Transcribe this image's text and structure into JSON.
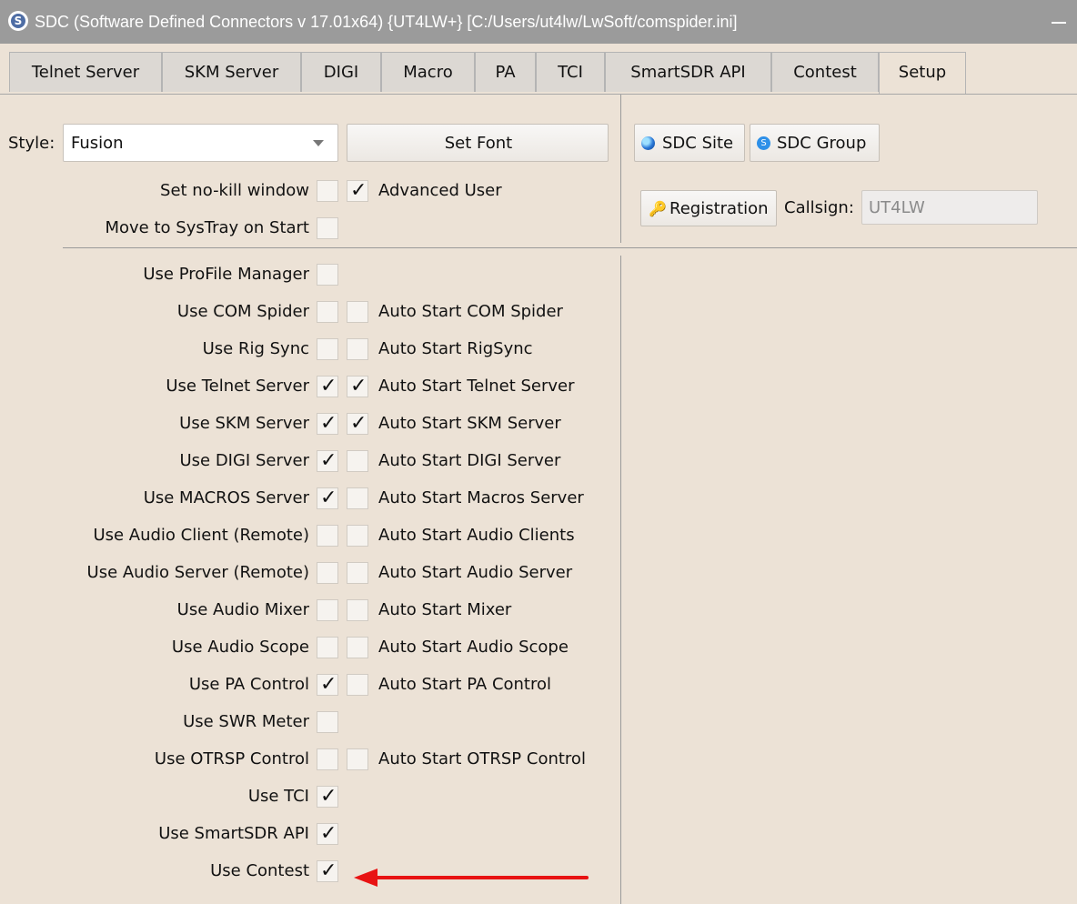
{
  "window": {
    "title": "SDC (Software Defined Connectors v 17.01x64) {UT4LW+} [C:/Users/ut4lw/LwSoft/comspider.ini]"
  },
  "tabs": [
    {
      "label": "Telnet Server",
      "active": false
    },
    {
      "label": "SKM Server",
      "active": false
    },
    {
      "label": "DIGI",
      "active": false
    },
    {
      "label": "Macro",
      "active": false
    },
    {
      "label": "PA",
      "active": false
    },
    {
      "label": "TCI",
      "active": false
    },
    {
      "label": "SmartSDR API",
      "active": false
    },
    {
      "label": "Contest",
      "active": false
    },
    {
      "label": "Setup",
      "active": true
    }
  ],
  "setup": {
    "style_label": "Style:",
    "style_value": "Fusion",
    "set_font_label": "Set Font",
    "no_kill_label": "Set no-kill window",
    "no_kill_checked": false,
    "advanced_user_checked": true,
    "advanced_user_label": "Advanced User",
    "systray_label": "Move to SysTray on Start",
    "systray_checked": false,
    "sdc_site_label": "SDC Site",
    "sdc_group_label": "SDC Group",
    "registration_label": "Registration",
    "callsign_label": "Callsign:",
    "callsign_value": "UT4LW",
    "options": [
      {
        "label": "Use ProFile Manager",
        "checked": false
      },
      {
        "label": "Use COM Spider",
        "checked": false,
        "auto_checked": false,
        "auto_label": "Auto Start COM Spider"
      },
      {
        "label": "Use Rig Sync",
        "checked": false,
        "auto_checked": false,
        "auto_label": "Auto Start RigSync"
      },
      {
        "label": "Use Telnet Server",
        "checked": true,
        "auto_checked": true,
        "auto_label": "Auto Start Telnet Server"
      },
      {
        "label": "Use SKM Server",
        "checked": true,
        "auto_checked": true,
        "auto_label": "Auto Start SKM Server"
      },
      {
        "label": "Use DIGI Server",
        "checked": true,
        "auto_checked": false,
        "auto_label": "Auto Start DIGI Server"
      },
      {
        "label": "Use MACROS Server",
        "checked": true,
        "auto_checked": false,
        "auto_label": "Auto Start Macros Server"
      },
      {
        "label": "Use Audio Client (Remote)",
        "checked": false,
        "auto_checked": false,
        "auto_label": "Auto Start Audio Clients"
      },
      {
        "label": "Use Audio Server (Remote)",
        "checked": false,
        "auto_checked": false,
        "auto_label": "Auto Start Audio Server"
      },
      {
        "label": "Use Audio Mixer",
        "checked": false,
        "auto_checked": false,
        "auto_label": "Auto Start Mixer"
      },
      {
        "label": "Use Audio Scope",
        "checked": false,
        "auto_checked": false,
        "auto_label": "Auto Start Audio Scope"
      },
      {
        "label": "Use PA Control",
        "checked": true,
        "auto_checked": false,
        "auto_label": "Auto Start PA Control"
      },
      {
        "label": "Use SWR Meter",
        "checked": false
      },
      {
        "label": "Use OTRSP Control",
        "checked": false,
        "auto_checked": false,
        "auto_label": "Auto Start OTRSP Control"
      },
      {
        "label": "Use TCI",
        "checked": true
      },
      {
        "label": "Use SmartSDR API",
        "checked": true
      },
      {
        "label": "Use Contest",
        "checked": true
      }
    ]
  },
  "annotation": {
    "color": "#e81313"
  }
}
